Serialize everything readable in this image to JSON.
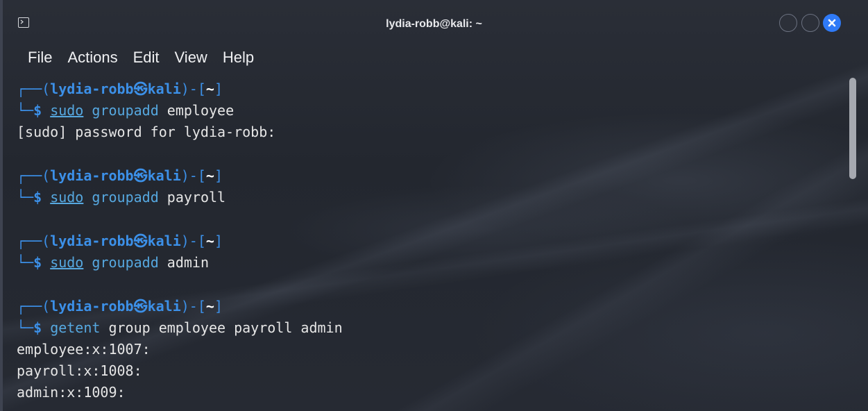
{
  "window": {
    "title": "lydia-robb@kali: ~"
  },
  "menu": {
    "items": [
      "File",
      "Actions",
      "Edit",
      "View",
      "Help"
    ]
  },
  "prompt": {
    "top_left": "┌──(",
    "user": "lydia-robb",
    "at_symbol": "㉿",
    "host": "kali",
    "mid": ")-[",
    "dir": "~",
    "close": "]",
    "bottom_left": "└─",
    "dollar": "$"
  },
  "session": [
    {
      "sudo": "sudo",
      "cmd": "groupadd",
      "args": " employee",
      "output": [
        "[sudo] password for lydia-robb:"
      ]
    },
    {
      "sudo": "sudo",
      "cmd": "groupadd",
      "args": " payroll",
      "output": []
    },
    {
      "sudo": "sudo",
      "cmd": "groupadd",
      "args": " admin",
      "output": []
    },
    {
      "sudo": "",
      "cmd": "getent",
      "args": " group employee payroll admin",
      "output": [
        "employee:x:1007:",
        "payroll:x:1008:",
        "admin:x:1009:"
      ]
    }
  ],
  "colors": {
    "prompt": "#3c90e8",
    "command": "#56a8e0",
    "close_button": "#2f7af7"
  },
  "icons": {
    "app": "terminal-icon",
    "close": "close-icon"
  }
}
